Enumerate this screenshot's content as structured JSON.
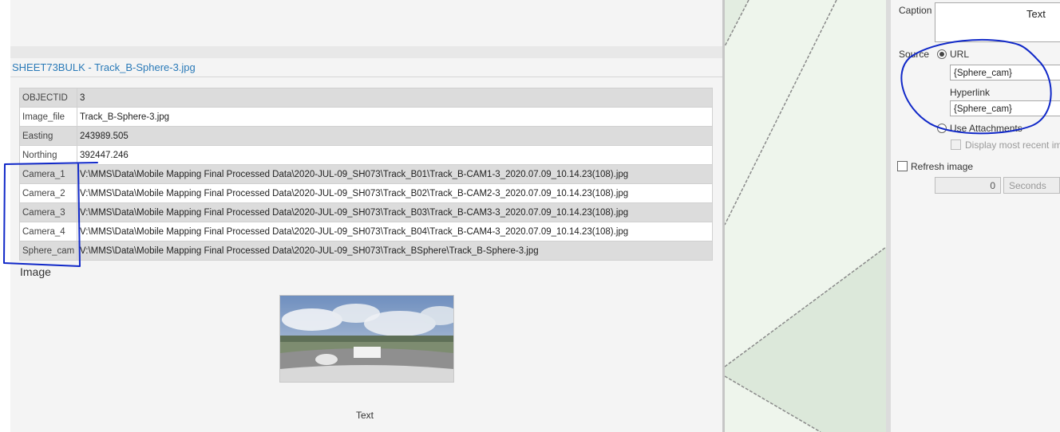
{
  "popup": {
    "title": "SHEET73BULK - Track_B-Sphere-3.jpg",
    "attributes": [
      {
        "key": "OBJECTID",
        "value": "3"
      },
      {
        "key": "Image_file",
        "value": "Track_B-Sphere-3.jpg"
      },
      {
        "key": "Easting",
        "value": "243989.505"
      },
      {
        "key": "Northing",
        "value": "392447.246"
      },
      {
        "key": "Camera_1",
        "value": "V:\\MMS\\Data\\Mobile Mapping Final Processed Data\\2020-JUL-09_SH073\\Track_B01\\Track_B-CAM1-3_2020.07.09_10.14.23(108).jpg"
      },
      {
        "key": "Camera_2",
        "value": "V:\\MMS\\Data\\Mobile Mapping Final Processed Data\\2020-JUL-09_SH073\\Track_B02\\Track_B-CAM2-3_2020.07.09_10.14.23(108).jpg"
      },
      {
        "key": "Camera_3",
        "value": "V:\\MMS\\Data\\Mobile Mapping Final Processed Data\\2020-JUL-09_SH073\\Track_B03\\Track_B-CAM3-3_2020.07.09_10.14.23(108).jpg"
      },
      {
        "key": "Camera_4",
        "value": "V:\\MMS\\Data\\Mobile Mapping Final Processed Data\\2020-JUL-09_SH073\\Track_B04\\Track_B-CAM4-3_2020.07.09_10.14.23(108).jpg"
      },
      {
        "key": "Sphere_cam",
        "value": "V:\\MMS\\Data\\Mobile Mapping Final Processed Data\\2020-JUL-09_SH073\\Track_BSphere\\Track_B-Sphere-3.jpg"
      }
    ],
    "image_label": "Image",
    "bottom_text": "Text"
  },
  "image_panel": {
    "caption_label": "Caption",
    "caption_text": "Text",
    "source_label": "Source",
    "url_option": "URL",
    "url_value": "{Sphere_cam}",
    "hyperlink_label": "Hyperlink",
    "hyperlink_value": "{Sphere_cam}",
    "attachments_option": "Use Attachments",
    "display_recent_label": "Display most recent im",
    "refresh_label": "Refresh image",
    "refresh_value": "0",
    "refresh_unit": "Seconds",
    "url_selected": true,
    "refresh_checked": false
  },
  "colors": {
    "title_link": "#2a7ab8",
    "annotation_ink": "#1028c8",
    "map_fill": "#eef5ec"
  }
}
